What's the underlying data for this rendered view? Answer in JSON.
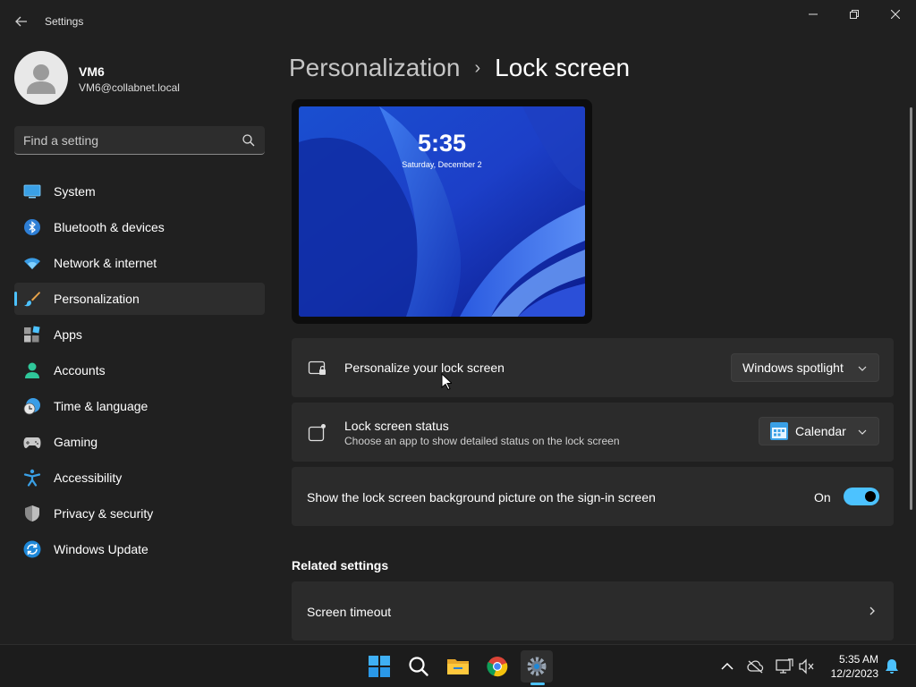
{
  "window": {
    "app_title": "Settings"
  },
  "user": {
    "name": "VM6",
    "email": "VM6@collabnet.local"
  },
  "search": {
    "placeholder": "Find a setting"
  },
  "sidebar": {
    "items": [
      {
        "label": "System",
        "icon": "system-icon"
      },
      {
        "label": "Bluetooth & devices",
        "icon": "bluetooth-icon"
      },
      {
        "label": "Network & internet",
        "icon": "wifi-icon"
      },
      {
        "label": "Personalization",
        "icon": "brush-icon",
        "selected": true
      },
      {
        "label": "Apps",
        "icon": "apps-icon"
      },
      {
        "label": "Accounts",
        "icon": "accounts-icon"
      },
      {
        "label": "Time & language",
        "icon": "clock-globe-icon"
      },
      {
        "label": "Gaming",
        "icon": "gamepad-icon"
      },
      {
        "label": "Accessibility",
        "icon": "accessibility-icon"
      },
      {
        "label": "Privacy & security",
        "icon": "shield-icon"
      },
      {
        "label": "Windows Update",
        "icon": "update-icon"
      }
    ]
  },
  "breadcrumb": {
    "parent": "Personalization",
    "separator": "›",
    "current": "Lock screen"
  },
  "preview": {
    "time": "5:35",
    "date": "Saturday, December 2"
  },
  "settings": {
    "personalize": {
      "title": "Personalize your lock screen",
      "value": "Windows spotlight"
    },
    "status": {
      "title": "Lock screen status",
      "subtitle": "Choose an app to show detailed status on the lock screen",
      "value": "Calendar"
    },
    "signin_bg": {
      "title": "Show the lock screen background picture on the sign-in screen",
      "state_label": "On",
      "enabled": true
    }
  },
  "related": {
    "heading": "Related settings",
    "items": [
      {
        "label": "Screen timeout"
      }
    ]
  },
  "taskbar": {
    "apps": [
      "start-icon",
      "search-icon",
      "file-explorer-icon",
      "chrome-icon",
      "settings-icon"
    ],
    "active_app": "settings-icon",
    "clock_time": "5:35 AM",
    "clock_date": "12/2/2023"
  },
  "colors": {
    "accent": "#4cc2ff",
    "background": "#202020",
    "card": "#2b2b2b"
  }
}
